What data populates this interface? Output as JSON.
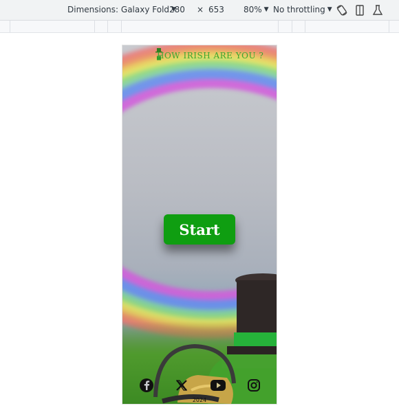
{
  "devtools": {
    "dimensions_label": "Dimensions: Galaxy Fold",
    "width": "280",
    "times": "×",
    "height": "653",
    "zoom": "80%",
    "throttling": "No throttling",
    "icons": [
      "rotate-icon",
      "device-frame-icon",
      "sensors-icon"
    ]
  },
  "page": {
    "title": "HOW IRISH ARE YOU ?",
    "start_label": "Start",
    "social": [
      "facebook-icon",
      "x-icon",
      "youtube-icon",
      "instagram-icon"
    ],
    "year": "2024",
    "colors": {
      "start_button": "#0f9e11",
      "title": "#3aa632"
    }
  }
}
